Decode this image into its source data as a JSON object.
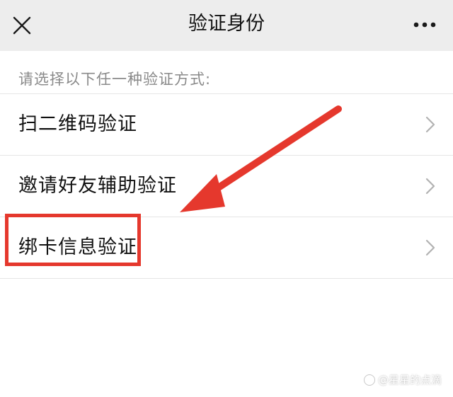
{
  "navbar": {
    "title": "验证身份",
    "close_icon": "close-icon",
    "more_icon": "more-horizontal-icon"
  },
  "hint": "请选择以下任一种验证方式:",
  "options": [
    {
      "label": "扫二维码验证",
      "icon": "chevron-right-icon"
    },
    {
      "label": "邀请好友辅助验证",
      "icon": "chevron-right-icon"
    },
    {
      "label": "绑卡信息验证",
      "icon": "chevron-right-icon"
    }
  ],
  "annotation": {
    "highlight_color": "#e5382d",
    "arrow_color": "#e5382d"
  },
  "watermark": {
    "text": "@星星的点滴"
  },
  "colors": {
    "navbar_bg": "#ededed",
    "divider": "#e6e6e6",
    "hint_text": "#8a8a8a",
    "primary_text": "#111111"
  }
}
